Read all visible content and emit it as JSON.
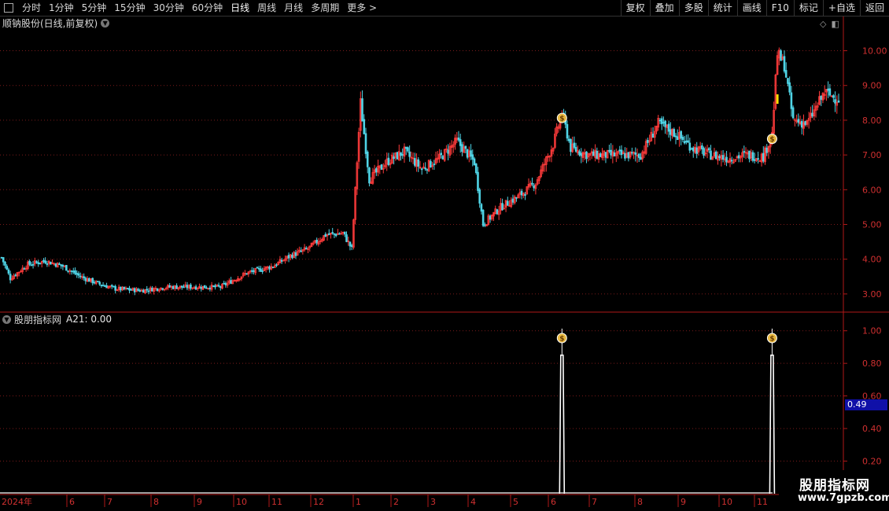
{
  "toolbar": {
    "periods": [
      "分时",
      "1分钟",
      "5分钟",
      "15分钟",
      "30分钟",
      "60分钟",
      "日线",
      "周线",
      "月线",
      "多周期",
      "更多 >"
    ],
    "active_period": "日线",
    "right_buttons": [
      "复权",
      "叠加",
      "多股",
      "统计",
      "画线",
      "F10",
      "标记",
      "+自选",
      "返回"
    ]
  },
  "stock": {
    "title": "顺钠股份(日线,前复权)"
  },
  "indicator": {
    "name": "股朋指标网",
    "value_text": "A21: 0.00"
  },
  "cursor_value": "0.49",
  "watermark": {
    "title": "股朋指标网",
    "url": "www.7gpzb.com"
  },
  "colors": {
    "up": "#ff3b3b",
    "down": "#4fd4e6",
    "grid": "#7a1a1a",
    "axis": "#b01818",
    "axis_text": "#d03030",
    "signal_line": "#ffffff"
  },
  "chart_data": [
    {
      "type": "candlestick",
      "title": "顺钠股份(日线,前复权)",
      "y_ticks": [
        "10.00",
        "9.00",
        "8.00",
        "7.00",
        "6.00",
        "5.00",
        "4.00",
        "3.00"
      ],
      "ylim": [
        2.5,
        10.6
      ],
      "x_ticks": [
        "2024年",
        "6",
        "7",
        "8",
        "9",
        "10",
        "11",
        "12",
        "1",
        "2",
        "3",
        "4",
        "5",
        "6",
        "7",
        "8",
        "9",
        "10",
        "11"
      ],
      "close_series": [
        {
          "x": 0,
          "y": 4.05
        },
        {
          "x": 5,
          "y": 3.45
        },
        {
          "x": 15,
          "y": 3.85
        },
        {
          "x": 25,
          "y": 3.95
        },
        {
          "x": 35,
          "y": 3.8
        },
        {
          "x": 45,
          "y": 3.5
        },
        {
          "x": 55,
          "y": 3.3
        },
        {
          "x": 65,
          "y": 3.15
        },
        {
          "x": 80,
          "y": 3.1
        },
        {
          "x": 95,
          "y": 3.2
        },
        {
          "x": 110,
          "y": 3.2
        },
        {
          "x": 125,
          "y": 3.2
        },
        {
          "x": 140,
          "y": 3.6
        },
        {
          "x": 155,
          "y": 3.8
        },
        {
          "x": 165,
          "y": 4.1
        },
        {
          "x": 175,
          "y": 4.3
        },
        {
          "x": 185,
          "y": 4.7
        },
        {
          "x": 195,
          "y": 4.75
        },
        {
          "x": 200,
          "y": 4.3
        },
        {
          "x": 205,
          "y": 8.5
        },
        {
          "x": 210,
          "y": 6.3
        },
        {
          "x": 220,
          "y": 6.8
        },
        {
          "x": 230,
          "y": 7.1
        },
        {
          "x": 240,
          "y": 6.6
        },
        {
          "x": 250,
          "y": 6.9
        },
        {
          "x": 260,
          "y": 7.4
        },
        {
          "x": 270,
          "y": 6.8
        },
        {
          "x": 275,
          "y": 5.0
        },
        {
          "x": 285,
          "y": 5.5
        },
        {
          "x": 295,
          "y": 5.8
        },
        {
          "x": 305,
          "y": 6.2
        },
        {
          "x": 315,
          "y": 7.3
        },
        {
          "x": 320,
          "y": 8.2
        },
        {
          "x": 325,
          "y": 7.2
        },
        {
          "x": 335,
          "y": 7.0
        },
        {
          "x": 350,
          "y": 7.0
        },
        {
          "x": 365,
          "y": 7.0
        },
        {
          "x": 375,
          "y": 7.9
        },
        {
          "x": 385,
          "y": 7.6
        },
        {
          "x": 395,
          "y": 7.2
        },
        {
          "x": 405,
          "y": 7.0
        },
        {
          "x": 415,
          "y": 6.9
        },
        {
          "x": 425,
          "y": 7.0
        },
        {
          "x": 435,
          "y": 6.95
        },
        {
          "x": 440,
          "y": 7.6
        },
        {
          "x": 443,
          "y": 9.9
        },
        {
          "x": 447,
          "y": 9.6
        },
        {
          "x": 452,
          "y": 8.0
        },
        {
          "x": 460,
          "y": 7.9
        },
        {
          "x": 470,
          "y": 8.8
        },
        {
          "x": 478,
          "y": 8.6
        }
      ],
      "signals_x": [
        320,
        440
      ],
      "signal_icon": "money-bag-icon"
    },
    {
      "type": "line",
      "title": "股朋指标网",
      "y_ticks": [
        "1.00",
        "0.80",
        "0.60",
        "0.40",
        "0.20"
      ],
      "ylim": [
        0,
        1.1
      ],
      "pulses": [
        {
          "x": 320,
          "y": 0.85
        },
        {
          "x": 440,
          "y": 0.85
        }
      ],
      "signal_icon": "money-bag-icon"
    }
  ]
}
